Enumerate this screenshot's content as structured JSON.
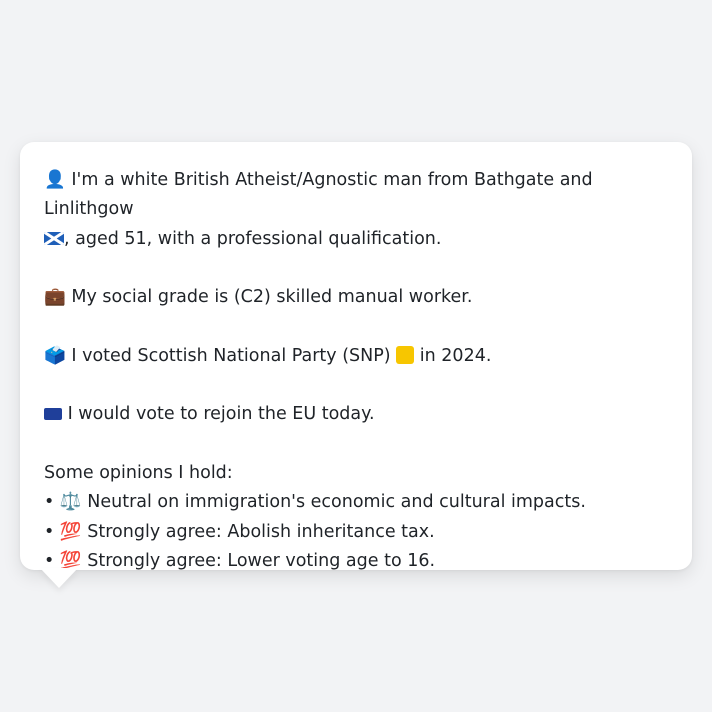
{
  "card": {
    "intro_icon": "👤",
    "intro_text": "I'm a white British Atheist/Agnostic man from Bathgate and Linlithgow",
    "flag_icon": "scotland-flag",
    "intro_tail": ", aged 51, with a professional qualification.",
    "grade_icon": "💼",
    "grade_text": "My social grade is (C2) skilled manual worker.",
    "vote_icon": "🗳️",
    "vote_text_before": "I voted Scottish National Party (SNP)",
    "party_color": "#f7c600",
    "vote_text_after": "in 2024.",
    "eu_icon": "eu-flag",
    "eu_text": "I would vote to rejoin the EU today.",
    "opinions_heading": "Some opinions I hold:",
    "opinions": [
      {
        "bullet": "•",
        "icon": "⚖️",
        "text": "Neutral on immigration's economic and cultural impacts."
      },
      {
        "bullet": "•",
        "icon": "💯",
        "text": "Strongly agree: Abolish inheritance tax."
      },
      {
        "bullet": "•",
        "icon": "💯",
        "text": "Strongly agree: Lower voting age to 16."
      }
    ]
  }
}
